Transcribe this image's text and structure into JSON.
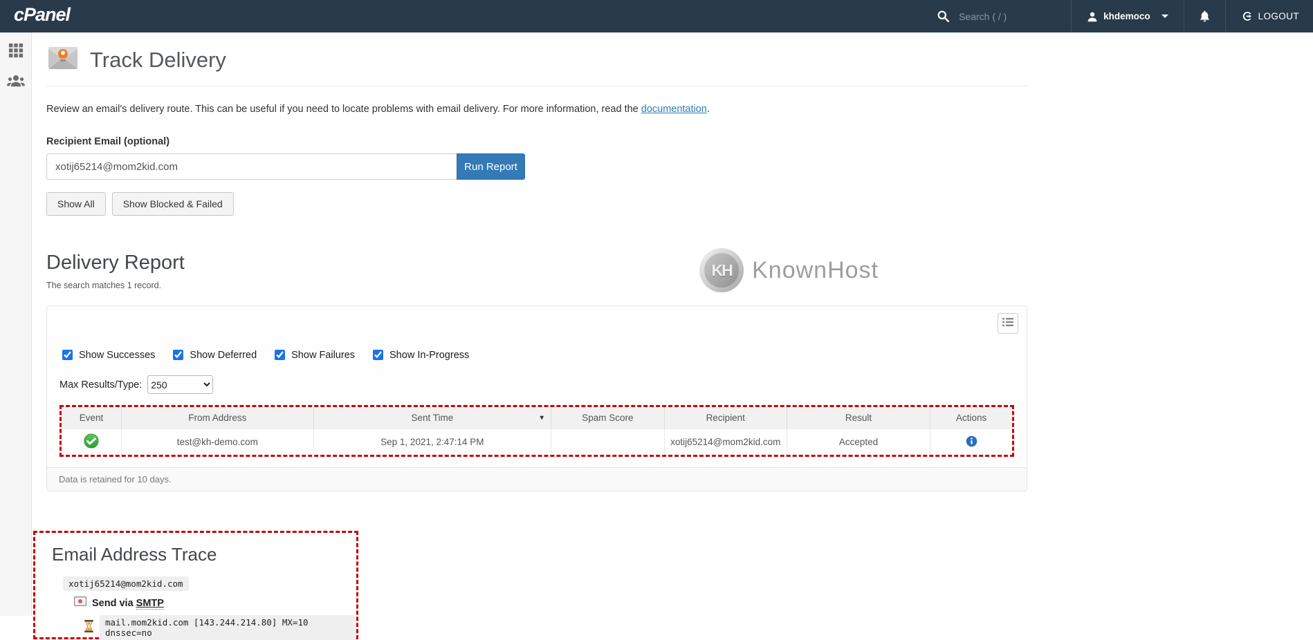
{
  "navbar": {
    "brand": "cPanel",
    "search_placeholder": "Search ( / )",
    "username": "khdemoco",
    "logout_label": "LOGOUT"
  },
  "page": {
    "title": "Track Delivery",
    "description_prefix": "Review an email's delivery route. This can be useful if you need to locate problems with email delivery. For more information, read the ",
    "description_link": "documentation",
    "description_suffix": "."
  },
  "form": {
    "recipient_label": "Recipient Email (optional)",
    "recipient_value": "xotij65214@mom2kid.com",
    "run_report_label": "Run Report",
    "show_all_label": "Show All",
    "show_blocked_label": "Show Blocked & Failed"
  },
  "report": {
    "title": "Delivery Report",
    "match_text": "The search matches 1 record.",
    "checkboxes": [
      {
        "label": "Show Successes",
        "checked": true
      },
      {
        "label": "Show Deferred",
        "checked": true
      },
      {
        "label": "Show Failures",
        "checked": true
      },
      {
        "label": "Show In-Progress",
        "checked": true
      }
    ],
    "max_results_label": "Max Results/Type:",
    "max_results_value": "250",
    "retention_note": "Data is retained for 10 days."
  },
  "table": {
    "columns": [
      "Event",
      "From Address",
      "Sent Time",
      "Spam Score",
      "Recipient",
      "Result",
      "Actions"
    ],
    "sorted_column": "Sent Time",
    "rows": [
      {
        "event": "success",
        "from": "test@kh-demo.com",
        "sent_time": "Sep 1, 2021, 2:47:14 PM",
        "spam_score": "",
        "recipient": "xotij65214@mom2kid.com",
        "result": "Accepted",
        "action": "info"
      }
    ]
  },
  "trace": {
    "title": "Email Address Trace",
    "address": "xotij65214@mom2kid.com",
    "send_via_prefix": "Send via ",
    "send_via_link": "SMTP",
    "mx_record": "mail.mom2kid.com [143.244.214.80] MX=10 dnssec=no"
  },
  "branding": {
    "knownhost_badge": "KH",
    "knownhost_label": "KnownHost"
  },
  "colors": {
    "navbar_bg": "#293a4a",
    "primary_button": "#337ab7",
    "link": "#2a7cbd",
    "annotation_red": "#c40505",
    "success_green": "#3faf46",
    "info_blue": "#2a6fbb"
  }
}
